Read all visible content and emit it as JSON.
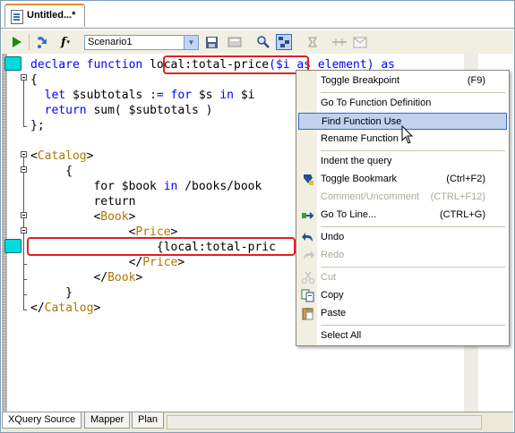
{
  "document_tab": {
    "title": "Untitled...*",
    "icon": "xquery-file-icon"
  },
  "toolbar": {
    "scenario_value": "Scenario1",
    "icons": [
      "run-icon",
      "debug-step-icon",
      "function-icon",
      "save-icon",
      "open-icon",
      "search-icon",
      "map-icon",
      "breakpoint-icon",
      "compare-icon",
      "mail-icon"
    ]
  },
  "code": {
    "lines": [
      {
        "segments": [
          {
            "t": "declare function ",
            "c": "kw"
          },
          {
            "t": "local:total-price",
            "c": ""
          },
          {
            "t": "($i as element) as",
            "c": "kw"
          }
        ]
      },
      {
        "segments": [
          {
            "t": "{",
            "c": ""
          }
        ]
      },
      {
        "segments": [
          {
            "t": "  let ",
            "c": "kw"
          },
          {
            "t": "$subtotals ",
            "c": ""
          },
          {
            "t": ":= for ",
            "c": "kw"
          },
          {
            "t": "$s ",
            "c": ""
          },
          {
            "t": "in ",
            "c": "kw"
          },
          {
            "t": "$i",
            "c": ""
          }
        ]
      },
      {
        "segments": [
          {
            "t": "  return ",
            "c": "kw"
          },
          {
            "t": "sum( $subtotals )",
            "c": ""
          }
        ]
      },
      {
        "segments": [
          {
            "t": "};",
            "c": ""
          }
        ]
      },
      {
        "segments": [
          {
            "t": "",
            "c": ""
          }
        ]
      },
      {
        "segments": [
          {
            "t": "<",
            "c": ""
          },
          {
            "t": "Catalog",
            "c": "tag"
          },
          {
            "t": ">",
            "c": ""
          }
        ]
      },
      {
        "segments": [
          {
            "t": "     {",
            "c": ""
          }
        ]
      },
      {
        "segments": [
          {
            "t": "         for ",
            "c": ""
          },
          {
            "t": "$book ",
            "c": ""
          },
          {
            "t": "in ",
            "c": "kw"
          },
          {
            "t": "/books/book",
            "c": ""
          }
        ]
      },
      {
        "segments": [
          {
            "t": "         return",
            "c": ""
          }
        ]
      },
      {
        "segments": [
          {
            "t": "         <",
            "c": ""
          },
          {
            "t": "Book",
            "c": "tag"
          },
          {
            "t": ">",
            "c": ""
          }
        ]
      },
      {
        "segments": [
          {
            "t": "              <",
            "c": ""
          },
          {
            "t": "Price",
            "c": "tag"
          },
          {
            "t": ">",
            "c": ""
          }
        ]
      },
      {
        "segments": [
          {
            "t": "                  {local:total-pric",
            "c": ""
          }
        ]
      },
      {
        "segments": [
          {
            "t": "              </",
            "c": ""
          },
          {
            "t": "Price",
            "c": "tag"
          },
          {
            "t": ">",
            "c": ""
          }
        ]
      },
      {
        "segments": [
          {
            "t": "         </",
            "c": ""
          },
          {
            "t": "Book",
            "c": "tag"
          },
          {
            "t": ">",
            "c": ""
          }
        ]
      },
      {
        "segments": [
          {
            "t": "     }",
            "c": ""
          }
        ]
      },
      {
        "segments": [
          {
            "t": "</",
            "c": ""
          },
          {
            "t": "Catalog",
            "c": "tag"
          },
          {
            "t": ">",
            "c": ""
          }
        ]
      }
    ]
  },
  "context_menu": {
    "items": [
      {
        "label": "Toggle Breakpoint",
        "shortcut": "(F9)",
        "enabled": true,
        "icon": ""
      },
      {
        "sep": true
      },
      {
        "label": "Go To Function Definition",
        "shortcut": "",
        "enabled": true,
        "icon": ""
      },
      {
        "label": "Find Function Use",
        "shortcut": "",
        "enabled": true,
        "icon": "",
        "hover": true
      },
      {
        "label": "Rename Function",
        "shortcut": "",
        "enabled": true,
        "icon": ""
      },
      {
        "sep": true
      },
      {
        "label": "Indent the query",
        "shortcut": "",
        "enabled": true,
        "icon": ""
      },
      {
        "label": "Toggle Bookmark",
        "shortcut": "(Ctrl+F2)",
        "enabled": true,
        "icon": "bookmark-icon"
      },
      {
        "label": "Comment/Uncomment",
        "shortcut": "(CTRL+F12)",
        "enabled": false,
        "icon": ""
      },
      {
        "label": "Go To Line...",
        "shortcut": "(CTRL+G)",
        "enabled": true,
        "icon": "goto-line-icon"
      },
      {
        "sep": true
      },
      {
        "label": "Undo",
        "shortcut": "",
        "enabled": true,
        "icon": "undo-icon"
      },
      {
        "label": "Redo",
        "shortcut": "",
        "enabled": false,
        "icon": "redo-icon"
      },
      {
        "sep": true
      },
      {
        "label": "Cut",
        "shortcut": "",
        "enabled": false,
        "icon": "cut-icon"
      },
      {
        "label": "Copy",
        "shortcut": "",
        "enabled": true,
        "icon": "copy-icon"
      },
      {
        "label": "Paste",
        "shortcut": "",
        "enabled": true,
        "icon": "paste-icon"
      },
      {
        "sep": true
      },
      {
        "label": "Select All",
        "shortcut": "",
        "enabled": true,
        "icon": ""
      }
    ]
  },
  "bottom_tabs": [
    "XQuery Source",
    "Mapper",
    "Plan"
  ],
  "colors": {
    "keyword": "#0000ff",
    "tag": "#b07500",
    "highlight": "#e02020",
    "breakpoint": "#00dcdc"
  }
}
